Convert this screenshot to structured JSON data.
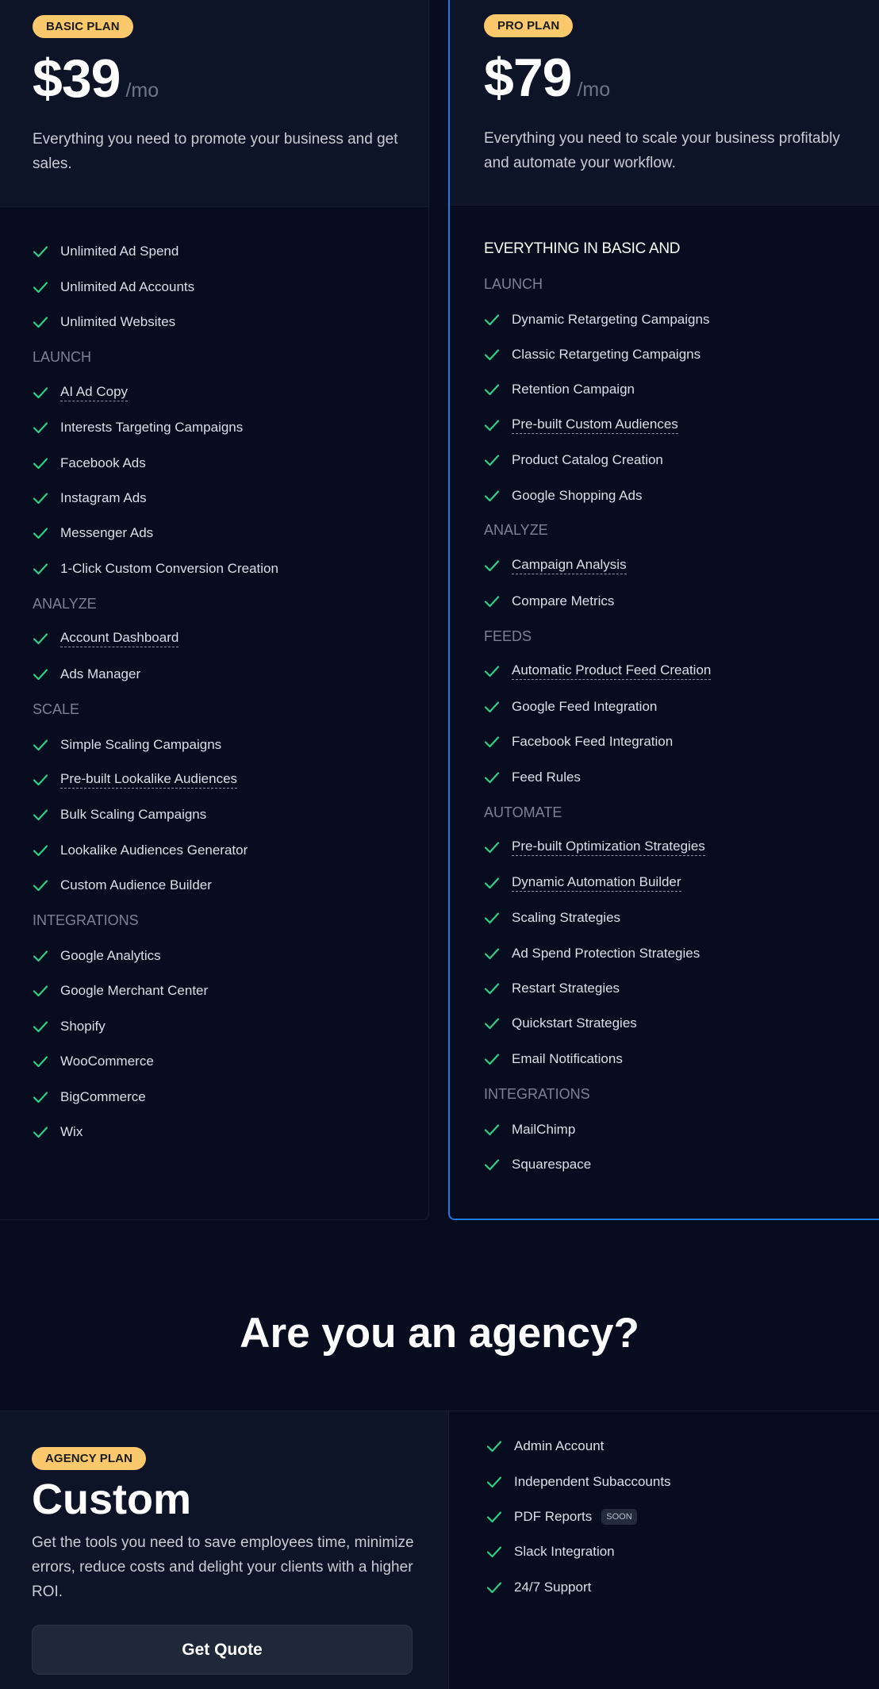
{
  "colors": {
    "background": "#070d1f",
    "card_header": "#0e1427",
    "badge": "#fbc96b",
    "check": "#2ecf85",
    "pro_border": "#1e7ae0"
  },
  "basic": {
    "badge": "BASIC PLAN",
    "price": "$39",
    "period": "/mo",
    "description": "Everything you need to promote your business and get sales.",
    "items": [
      {
        "type": "feature",
        "text": "Unlimited Ad Spend"
      },
      {
        "type": "feature",
        "text": "Unlimited Ad Accounts"
      },
      {
        "type": "feature",
        "text": "Unlimited Websites"
      },
      {
        "type": "section",
        "text": "LAUNCH"
      },
      {
        "type": "feature",
        "text": "AI Ad Copy",
        "dotted": true
      },
      {
        "type": "feature",
        "text": "Interests Targeting Campaigns"
      },
      {
        "type": "feature",
        "text": "Facebook Ads"
      },
      {
        "type": "feature",
        "text": "Instagram Ads"
      },
      {
        "type": "feature",
        "text": "Messenger Ads"
      },
      {
        "type": "feature",
        "text": "1-Click Custom Conversion Creation"
      },
      {
        "type": "section",
        "text": "ANALYZE"
      },
      {
        "type": "feature",
        "text": "Account Dashboard",
        "dotted": true
      },
      {
        "type": "feature",
        "text": "Ads Manager"
      },
      {
        "type": "section",
        "text": "SCALE"
      },
      {
        "type": "feature",
        "text": "Simple Scaling Campaigns"
      },
      {
        "type": "feature",
        "text": "Pre-built Lookalike Audiences",
        "dotted": true
      },
      {
        "type": "feature",
        "text": "Bulk Scaling Campaigns"
      },
      {
        "type": "feature",
        "text": "Lookalike Audiences Generator"
      },
      {
        "type": "feature",
        "text": "Custom Audience Builder"
      },
      {
        "type": "section",
        "text": "INTEGRATIONS"
      },
      {
        "type": "feature",
        "text": "Google Analytics"
      },
      {
        "type": "feature",
        "text": "Google Merchant Center"
      },
      {
        "type": "feature",
        "text": "Shopify"
      },
      {
        "type": "feature",
        "text": "WooCommerce"
      },
      {
        "type": "feature",
        "text": "BigCommerce"
      },
      {
        "type": "feature",
        "text": "Wix"
      }
    ]
  },
  "pro": {
    "badge": "PRO PLAN",
    "price": "$79",
    "period": "/mo",
    "description": "Everything you need to scale your business profitably and automate your workflow.",
    "items": [
      {
        "type": "heading",
        "text": "EVERYTHING IN BASIC AND"
      },
      {
        "type": "section",
        "text": "LAUNCH"
      },
      {
        "type": "feature",
        "text": "Dynamic Retargeting Campaigns"
      },
      {
        "type": "feature",
        "text": "Classic Retargeting Campaigns"
      },
      {
        "type": "feature",
        "text": "Retention Campaign"
      },
      {
        "type": "feature",
        "text": "Pre-built Custom Audiences",
        "dotted": true
      },
      {
        "type": "feature",
        "text": "Product Catalog Creation"
      },
      {
        "type": "feature",
        "text": "Google Shopping Ads"
      },
      {
        "type": "section",
        "text": "ANALYZE"
      },
      {
        "type": "feature",
        "text": "Campaign Analysis",
        "dotted": true
      },
      {
        "type": "feature",
        "text": "Compare Metrics"
      },
      {
        "type": "section",
        "text": "FEEDS"
      },
      {
        "type": "feature",
        "text": "Automatic Product Feed Creation",
        "dotted": true
      },
      {
        "type": "feature",
        "text": "Google Feed Integration"
      },
      {
        "type": "feature",
        "text": "Facebook Feed Integration"
      },
      {
        "type": "feature",
        "text": "Feed Rules"
      },
      {
        "type": "section",
        "text": "AUTOMATE"
      },
      {
        "type": "feature",
        "text": "Pre-built Optimization Strategies",
        "dotted": true
      },
      {
        "type": "feature",
        "text": "Dynamic Automation Builder",
        "dotted": true
      },
      {
        "type": "feature",
        "text": "Scaling Strategies"
      },
      {
        "type": "feature",
        "text": "Ad Spend Protection Strategies"
      },
      {
        "type": "feature",
        "text": "Restart Strategies"
      },
      {
        "type": "feature",
        "text": "Quickstart Strategies"
      },
      {
        "type": "feature",
        "text": "Email Notifications"
      },
      {
        "type": "section",
        "text": "INTEGRATIONS"
      },
      {
        "type": "feature",
        "text": "MailChimp"
      },
      {
        "type": "feature",
        "text": "Squarespace"
      }
    ]
  },
  "agency": {
    "heading": "Are you an agency?",
    "badge": "AGENCY PLAN",
    "price": "Custom",
    "description": "Get the tools you need to save employees time, minimize errors, reduce costs and delight your clients with a higher ROI.",
    "cta_label": "Get Quote",
    "features": [
      {
        "text": "Admin Account"
      },
      {
        "text": "Independent Subaccounts"
      },
      {
        "text": "PDF Reports",
        "tag": "SOON"
      },
      {
        "text": "Slack Integration"
      },
      {
        "text": "24/7 Support"
      }
    ]
  }
}
